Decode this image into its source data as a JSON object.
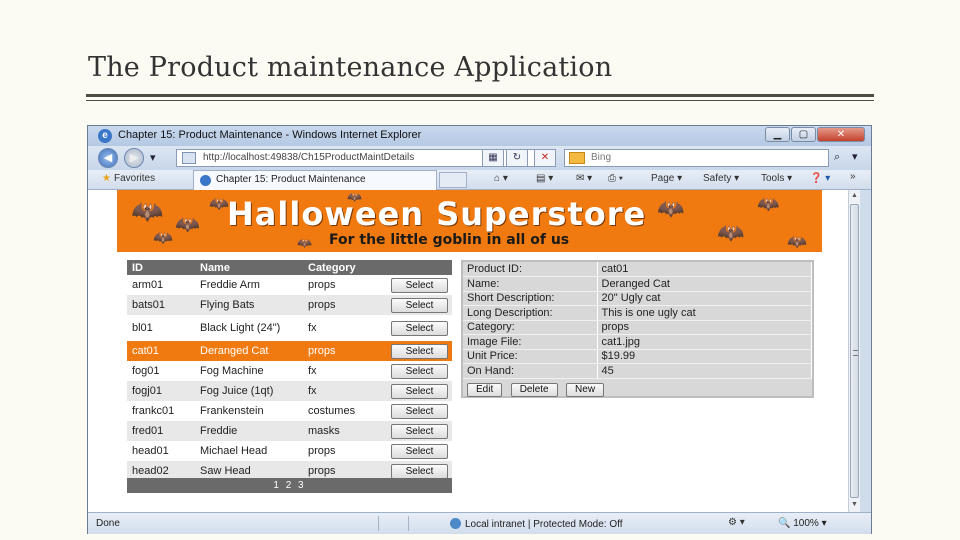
{
  "slide": {
    "title": "The Product maintenance Application"
  },
  "browser": {
    "window_title": "Chapter 15: Product Maintenance - Windows Internet Explorer",
    "url": "http://localhost:49838/Ch15ProductMaintDetails",
    "search_placeholder": "Bing",
    "favorites_label": "Favorites",
    "tab_label": "Chapter 15: Product Maintenance",
    "commands": {
      "page": "Page",
      "safety": "Safety",
      "tools": "Tools"
    },
    "status": {
      "done": "Done",
      "zone": "Local intranet | Protected Mode: Off",
      "zoom": "100%"
    }
  },
  "banner": {
    "headline": "Halloween Superstore",
    "tagline": "For the little goblin in all of us"
  },
  "grid": {
    "headers": [
      "ID",
      "Name",
      "Category"
    ],
    "select_label": "Select",
    "rows": [
      {
        "id": "arm01",
        "name": "Freddie Arm",
        "category": "props"
      },
      {
        "id": "bats01",
        "name": "Flying Bats",
        "category": "props"
      },
      {
        "id": "bl01",
        "name": "Black Light (24\")",
        "category": "fx"
      },
      {
        "id": "cat01",
        "name": "Deranged Cat",
        "category": "props"
      },
      {
        "id": "fog01",
        "name": "Fog Machine",
        "category": "fx"
      },
      {
        "id": "fogj01",
        "name": "Fog Juice (1qt)",
        "category": "fx"
      },
      {
        "id": "frankc01",
        "name": "Frankenstein",
        "category": "costumes"
      },
      {
        "id": "fred01",
        "name": "Freddie",
        "category": "masks"
      },
      {
        "id": "head01",
        "name": "Michael Head",
        "category": "props"
      },
      {
        "id": "head02",
        "name": "Saw Head",
        "category": "props"
      }
    ],
    "pager": "1 2 3"
  },
  "details": {
    "fields": [
      {
        "label": "Product ID:",
        "value": "cat01"
      },
      {
        "label": "Name:",
        "value": "Deranged Cat"
      },
      {
        "label": "Short Description:",
        "value": "20\" Ugly cat"
      },
      {
        "label": "Long Description:",
        "value": "This is one ugly cat"
      },
      {
        "label": "Category:",
        "value": "props"
      },
      {
        "label": "Image File:",
        "value": "cat1.jpg"
      },
      {
        "label": "Unit Price:",
        "value": "$19.99"
      },
      {
        "label": "On Hand:",
        "value": "45"
      }
    ],
    "buttons": {
      "edit": "Edit",
      "delete": "Delete",
      "new": "New"
    }
  },
  "colors": {
    "accent": "#f07a10",
    "grid_header": "#6a6a6a"
  }
}
